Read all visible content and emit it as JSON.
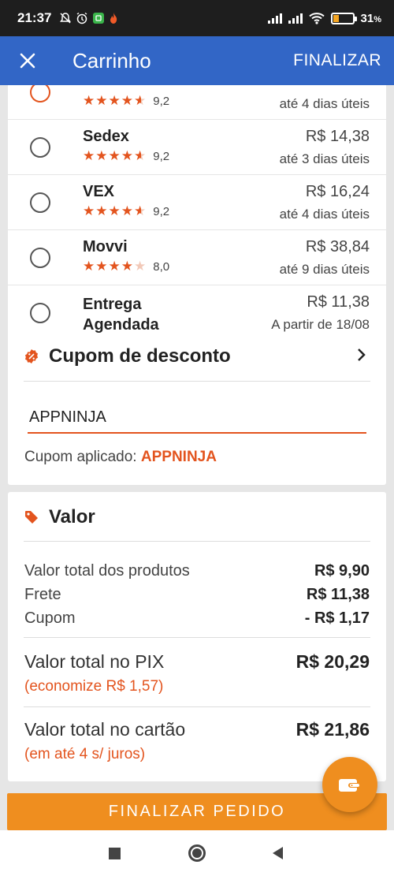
{
  "status_bar": {
    "time": "21:37",
    "battery": "31",
    "battery_unit": "%",
    "battery_level": 0.31,
    "icons": [
      "mute-icon",
      "alarm-icon",
      "app-icon",
      "fire-icon",
      "signal-icon",
      "signal-icon",
      "wifi-icon",
      "battery-icon"
    ]
  },
  "app_bar": {
    "close_icon": "close-icon",
    "title": "Carrinho",
    "action": "FINALIZAR"
  },
  "shipping": {
    "options": [
      {
        "name": "",
        "rating": "9,2",
        "rating_value": 4.6,
        "price": "",
        "eta": "até 4 dias úteis",
        "selected": true
      },
      {
        "name": "Sedex",
        "rating": "9,2",
        "rating_value": 4.6,
        "price": "R$ 14,38",
        "eta": "até 3 dias úteis",
        "selected": false
      },
      {
        "name": "VEX",
        "rating": "9,2",
        "rating_value": 4.6,
        "price": "R$ 16,24",
        "eta": "até 4 dias úteis",
        "selected": false
      },
      {
        "name": "Movvi",
        "rating": "8,0",
        "rating_value": 4.0,
        "price": "R$ 38,84",
        "eta": "até 9 dias úteis",
        "selected": false
      }
    ],
    "scheduled": {
      "name": "Entrega Agendada",
      "price": "R$ 11,38",
      "eta": "A partir de 18/08"
    }
  },
  "coupon": {
    "title": "Cupom de desconto",
    "icon": "discount-badge-icon",
    "value": "APPNINJA",
    "applied_label": "Cupom aplicado: ",
    "applied_code": "APPNINJA"
  },
  "value": {
    "title": "Valor",
    "icon": "price-tag-icon",
    "rows": [
      {
        "label": "Valor total dos produtos",
        "amount": "R$ 9,90"
      },
      {
        "label": "Frete",
        "amount": "R$ 11,38"
      },
      {
        "label": "Cupom",
        "amount": "- R$ 1,17"
      }
    ],
    "pix": {
      "label": "Valor total no PIX",
      "sub": "(economize R$ 1,57)",
      "amount": "R$ 20,29"
    },
    "card": {
      "label": "Valor total no cartão",
      "sub": "(em até 4 s/ juros)",
      "amount": "R$ 21,86"
    }
  },
  "checkout_button": "FINALIZAR PEDIDO",
  "colors": {
    "app_bar": "#3266c6",
    "accent": "#e3541e",
    "button": "#ef8e1f"
  }
}
